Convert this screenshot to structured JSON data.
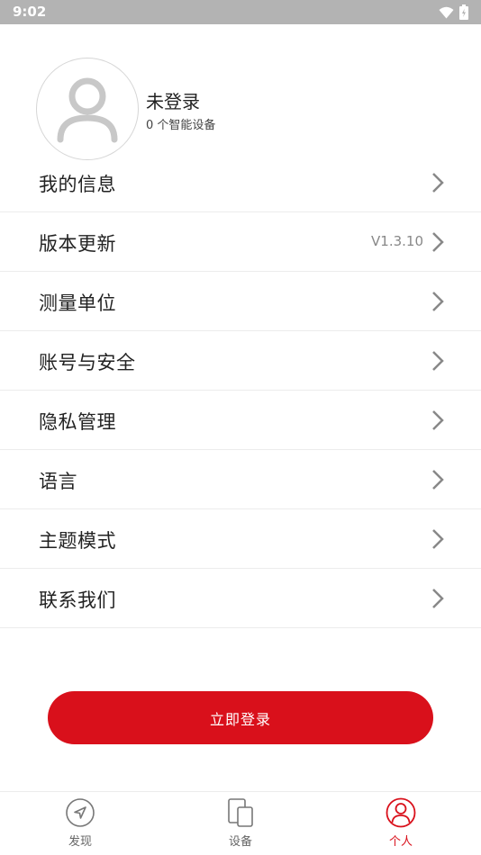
{
  "status_bar": {
    "time": "9:02"
  },
  "profile": {
    "username": "未登录",
    "device_count": "0 个智能设备"
  },
  "menu": {
    "items": [
      {
        "label": "我的信息",
        "value": ""
      },
      {
        "label": "版本更新",
        "value": "V1.3.10"
      },
      {
        "label": "测量单位",
        "value": ""
      },
      {
        "label": "账号与安全",
        "value": ""
      },
      {
        "label": "隐私管理",
        "value": ""
      },
      {
        "label": "语言",
        "value": ""
      },
      {
        "label": "主题模式",
        "value": ""
      },
      {
        "label": "联系我们",
        "value": ""
      }
    ]
  },
  "login_button": {
    "label": "立即登录"
  },
  "tabbar": {
    "tabs": [
      {
        "label": "发现",
        "icon": "compass-icon",
        "active": false
      },
      {
        "label": "设备",
        "icon": "devices-icon",
        "active": false
      },
      {
        "label": "个人",
        "icon": "person-icon",
        "active": true
      }
    ]
  },
  "colors": {
    "accent": "#d9101b",
    "status_bar": "#b3b3b3",
    "divider": "#ececec"
  }
}
